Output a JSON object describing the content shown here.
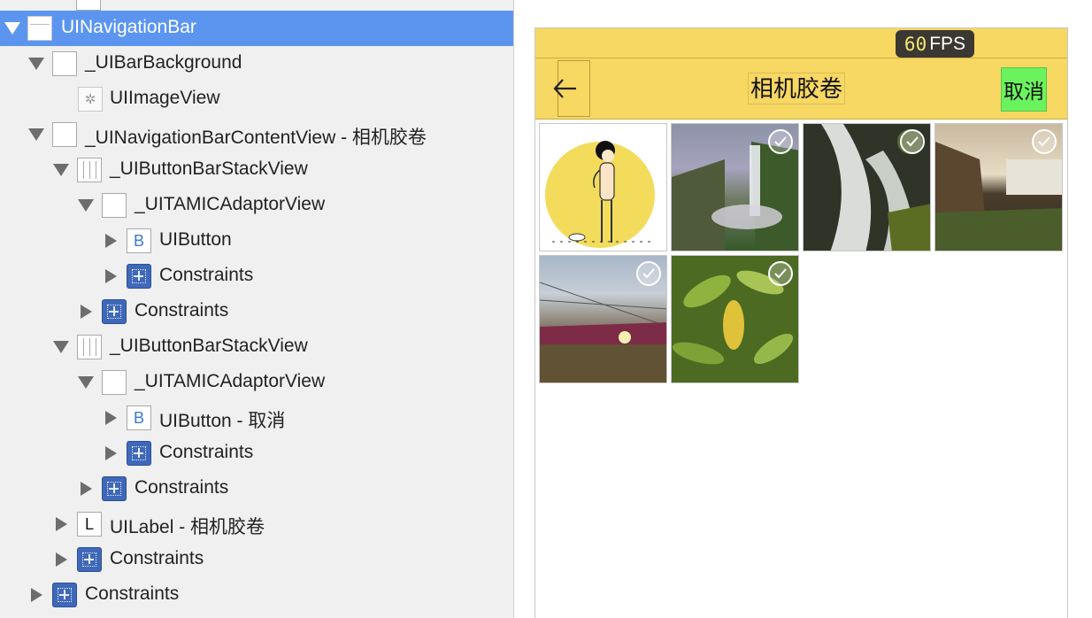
{
  "tree": {
    "rows": [
      {
        "label": "UINavigationBar",
        "icon": "navbar-icon"
      },
      {
        "label": "_UIBarBackground",
        "icon": "view-icon"
      },
      {
        "label": "UIImageView",
        "icon": "image-view-icon"
      },
      {
        "label": "_UINavigationBarContentView - 相机胶卷",
        "icon": "view-icon"
      },
      {
        "label": "_UIButtonBarStackView",
        "icon": "stack-view-icon"
      },
      {
        "label": "_UITAMICAdaptorView",
        "icon": "view-icon"
      },
      {
        "label": "UIButton",
        "icon": "button-icon",
        "glyph": "B"
      },
      {
        "label": "Constraints",
        "icon": "constraints-icon"
      },
      {
        "label": "Constraints",
        "icon": "constraints-icon"
      },
      {
        "label": "_UIButtonBarStackView",
        "icon": "stack-view-icon"
      },
      {
        "label": "_UITAMICAdaptorView",
        "icon": "view-icon"
      },
      {
        "label": "UIButton - 取消",
        "icon": "button-icon",
        "glyph": "B"
      },
      {
        "label": "Constraints",
        "icon": "constraints-icon"
      },
      {
        "label": "Constraints",
        "icon": "constraints-icon"
      },
      {
        "label": "UILabel - 相机胶卷",
        "icon": "label-icon",
        "glyph": "L"
      },
      {
        "label": "Constraints",
        "icon": "constraints-icon"
      },
      {
        "label": "Constraints",
        "icon": "constraints-icon"
      }
    ]
  },
  "simulator": {
    "fps_value": "60",
    "fps_unit": "FPS",
    "nav_title": "相机胶卷",
    "cancel_label": "取消",
    "back_icon": "back-arrow-icon",
    "photos": [
      {
        "subject": "cartoon-figure",
        "checked": true
      },
      {
        "subject": "waterfall-mist",
        "checked": true
      },
      {
        "subject": "waterfall-rocks",
        "checked": true
      },
      {
        "subject": "waterfall-cliff",
        "checked": true
      },
      {
        "subject": "flower-field",
        "checked": true
      },
      {
        "subject": "green-leaves",
        "checked": true
      }
    ]
  },
  "colors": {
    "selection": "#5b95f0",
    "navbar": "#f6d862",
    "cancel_highlight": "#6bf35d",
    "constraint_icon": "#3f68b8"
  }
}
